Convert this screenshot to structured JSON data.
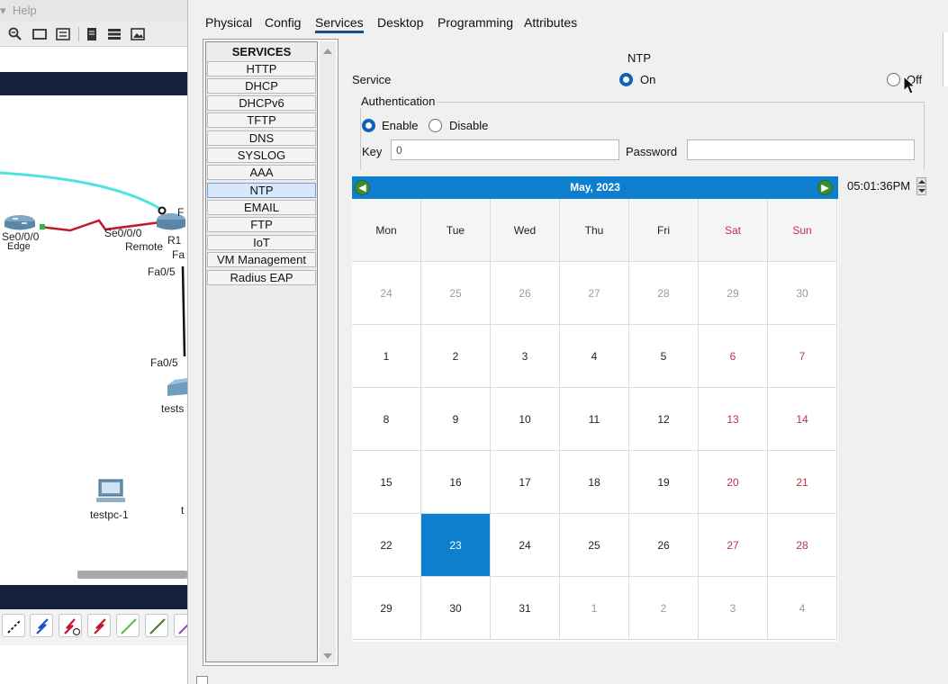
{
  "menubar": {
    "items": [
      "▾",
      "Help"
    ]
  },
  "toolbar": {
    "icons": [
      "zoom-out-icon",
      "window-icon",
      "notes-icon",
      "document-icon",
      "stack-icon",
      "image-icon"
    ]
  },
  "topology": {
    "labels": {
      "se_edge": "Se0/0/0",
      "edge": "Edge",
      "se_remote": "Se0/0/0",
      "remote": "Remote",
      "f_top": "F",
      "ri": "R1",
      "fa_right": "Fa",
      "fa05_top": "Fa0/5",
      "fa05_bottom": "Fa0/5",
      "tests": "tests",
      "testpc": "testpc-1",
      "t_stub": "t"
    },
    "colors": {
      "wireless": "#4fe3e0",
      "serial": "#c2182b",
      "ethernet": "#111111",
      "port_up": "#2fb74a"
    }
  },
  "dialog": {
    "tabs": [
      {
        "label": "Physical"
      },
      {
        "label": "Config"
      },
      {
        "label": "Services",
        "active": true
      },
      {
        "label": "Desktop"
      },
      {
        "label": "Programming"
      },
      {
        "label": "Attributes"
      }
    ],
    "services": {
      "header": "SERVICES",
      "items": [
        "HTTP",
        "DHCP",
        "DHCPv6",
        "TFTP",
        "DNS",
        "SYSLOG",
        "AAA",
        "NTP",
        "EMAIL",
        "FTP",
        "IoT",
        "VM Management",
        "Radius EAP"
      ],
      "selected": "NTP"
    },
    "ntp": {
      "title": "NTP",
      "service_label": "Service",
      "on_label": "On",
      "off_label": "Off",
      "service_state": "On",
      "authentication": {
        "legend": "Authentication",
        "enable_label": "Enable",
        "disable_label": "Disable",
        "state": "Enable",
        "key_label": "Key",
        "key_value": "0",
        "password_label": "Password",
        "password_value": ""
      },
      "calendar": {
        "title": "May, 2023",
        "weekdays": [
          "Mon",
          "Tue",
          "Wed",
          "Thu",
          "Fri",
          "Sat",
          "Sun"
        ],
        "weeks": [
          [
            "24",
            "25",
            "26",
            "27",
            "28",
            "29",
            "30"
          ],
          [
            "1",
            "2",
            "3",
            "4",
            "5",
            "6",
            "7"
          ],
          [
            "8",
            "9",
            "10",
            "11",
            "12",
            "13",
            "14"
          ],
          [
            "15",
            "16",
            "17",
            "18",
            "19",
            "20",
            "21"
          ],
          [
            "22",
            "23",
            "24",
            "25",
            "26",
            "27",
            "28"
          ],
          [
            "29",
            "30",
            "31",
            "1",
            "2",
            "3",
            "4"
          ]
        ],
        "selected_day": "23",
        "colors": {
          "header": "#0d7fce",
          "weekend": "#c0304a",
          "selected": "#0d7fce",
          "nav": "#3a8d34"
        }
      },
      "time": "05:01:36PM"
    }
  }
}
